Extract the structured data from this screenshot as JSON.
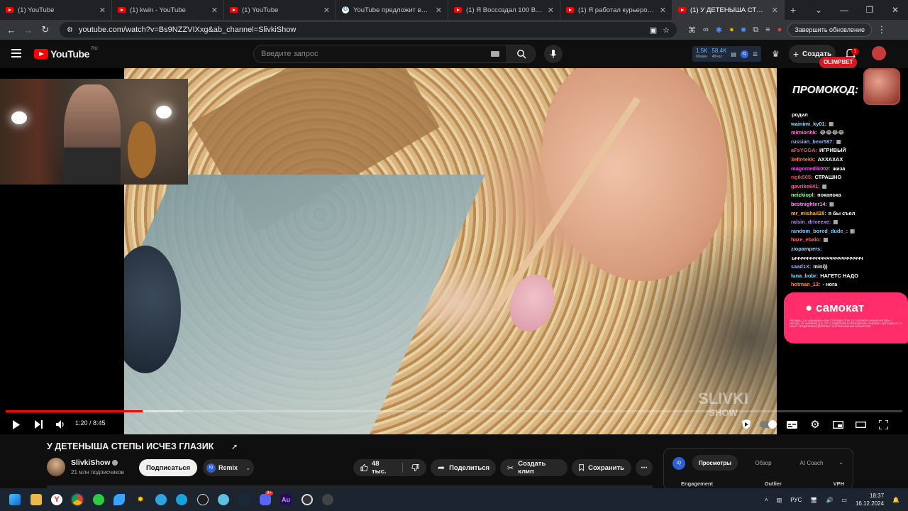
{
  "browser": {
    "tabs": [
      {
        "title": "(1) YouTube",
        "icon": "youtube-favicon",
        "active": false
      },
      {
        "title": "(1) kwin - YouTube",
        "icon": "youtube-favicon",
        "active": false
      },
      {
        "title": "(1) YouTube",
        "icon": "youtube-favicon",
        "active": false
      },
      {
        "title": "YouTube предложит возможн",
        "icon": "google-favicon",
        "active": false
      },
      {
        "title": "(1) Я Воссоздал 100 Вирусных",
        "icon": "youtube-favicon",
        "active": false
      },
      {
        "title": "(1) Я работал курьером в 16 л",
        "icon": "youtube-favicon",
        "active": false
      },
      {
        "title": "(1) У ДЕТЕНЫША СТЕПЫ ИСЧЕ",
        "icon": "youtube-favicon",
        "active": true
      }
    ],
    "url": "youtube.com/watch?v=Bs9NZZVIXxg&ab_channel=SlivkiShow",
    "update_label": "Завершить обновление"
  },
  "youtube": {
    "logo_text": "YouTube",
    "country_code": "RU",
    "search_placeholder": "Введите запрос",
    "stats": {
      "subs": "1.5K",
      "subs_sub": "60мин",
      "views": "58.4K",
      "views_sub": "48час",
      "ext_label": "IQ"
    },
    "create_label": "Создать",
    "notif_count": "1"
  },
  "video": {
    "watermark": "SLIVKI",
    "watermark_sub": "SHOW",
    "time": "1:20 / 8:45",
    "progress_fraction": 0.153,
    "buffer_fraction": 0.198,
    "overlay": {
      "brand": "OLIMPBET",
      "promo_label": "ПРОМОКОД:",
      "chat": [
        {
          "name": "",
          "msg": "родил",
          "color": "#ffffff"
        },
        {
          "name": "wainimi_ky01:",
          "msg": "▦",
          "color": "#7be3ff"
        },
        {
          "name": "mimionhk:",
          "msg": "😂😂😂😂",
          "color": "#ff7ad9"
        },
        {
          "name": "russian_bear587:",
          "msg": "▦",
          "color": "#8fb4ff"
        },
        {
          "name": "aFsYGGA:",
          "msg": "ИГРИВЫЙ",
          "color": "#ff4d7a"
        },
        {
          "name": "3efir4ekk:",
          "msg": "АХХАХАХ",
          "color": "#ff7a3d"
        },
        {
          "name": "magomedik002:",
          "msg": "жиза",
          "color": "#ff4dff"
        },
        {
          "name": "rigik505:",
          "msg": "СТРАШНО",
          "color": "#ff4d4d"
        },
        {
          "name": "gavrike641:",
          "msg": "▦",
          "color": "#ff5fa8"
        },
        {
          "name": "neizkiopl:",
          "msg": "покапока",
          "color": "#8fff8f"
        },
        {
          "name": "bestnighter14:",
          "msg": "▦",
          "color": "#ff8aff"
        },
        {
          "name": "mr_mishail28:",
          "msg": "я бы съел",
          "color": "#ffb14d"
        },
        {
          "name": "raisin_driveexe:",
          "msg": "▦",
          "color": "#b88aff"
        },
        {
          "name": "random_bored_dude_:",
          "msg": "▦",
          "color": "#7ad0ff"
        },
        {
          "name": "haze_ebalo:",
          "msg": "▦",
          "color": "#ff6b6b"
        },
        {
          "name": "ziopampers:",
          "msg": "",
          "color": "#9ad7ff"
        },
        {
          "name": "",
          "msg": "ычччччччччччччччччччччч",
          "color": "#ffffff"
        },
        {
          "name": "saad1X:",
          "msg": "mini))",
          "color": "#8fb4ff"
        },
        {
          "name": "luna_bobr:",
          "msg": "НАГЕТС НАДО",
          "color": "#7be3ff"
        },
        {
          "name": "hotman_13:",
          "msg": "- нога",
          "color": "#ff8a4d"
        }
      ],
      "ad_brand": "самокат",
      "ad_fine": "РЕКЛАМА. ООО «ДИНАМИКА» ИНН 7707436081 ОГРН 1217700000000 «УМНЫЙ РИТЕЙЛ», Г. МОСКВА, УЛ. КАРАВАЕВ, Д. 5, СТР. 3. ПОДРОБНЕЕ В ПРИЛОЖЕНИИ «САМОКАТ». ДОСТАВКА ОТ 15 МИНУТ. ПРЕДЛОЖЕНИЕ ДЕЙСТВУЕТ В ОГРАНИЧЕННОМ КОЛИЧЕСТВЕ."
    },
    "title": "У ДЕТЕНЫША СТЕПЫ ИСЧЕЗ ГЛАЗИК",
    "channel": {
      "name": "SlivkiShow",
      "subs": "21 млн подписчиков"
    },
    "subscribe_label": "Подписаться",
    "remix_label": "Remix",
    "likes": "48 тыс.",
    "share_label": "Поделиться",
    "clip_label": "Создать клип",
    "save_label": "Сохранить"
  },
  "side_panel": {
    "tabs": [
      "Просмотры",
      "Обзор",
      "AI Coach"
    ],
    "active_tab": "Просмотры",
    "row": [
      "Engagement",
      "Outlier",
      "VPH"
    ]
  },
  "taskbar": {
    "lang": "РУС",
    "time": "18:37",
    "date": "16.12.2024",
    "discord_badge": "9+"
  }
}
